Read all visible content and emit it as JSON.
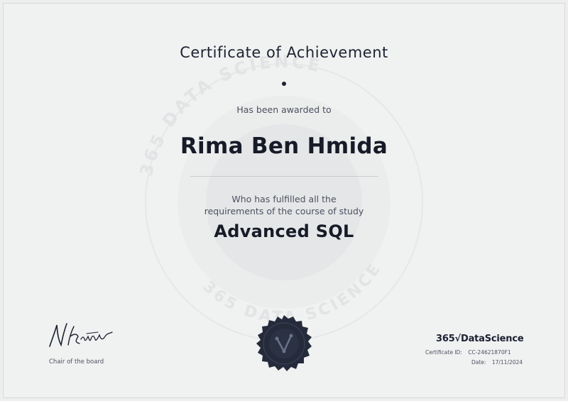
{
  "certificate": {
    "title": "Certificate of Achievement",
    "awarded_text": "Has been awarded to",
    "recipient_name": "Rima Ben Hmida",
    "fulfilled_line1": "Who has fulfilled all the",
    "fulfilled_line2": "requirements of the course of study",
    "course_name": "Advanced SQL"
  },
  "signature": {
    "role": "Chair of the board",
    "signature_text": "N Krastev"
  },
  "brand": {
    "name": "365√DataScience",
    "watermark_text": "365 DATA SCIENCE"
  },
  "meta": {
    "id_label": "Certificate ID:",
    "id_value": "CC-24621870F1",
    "date_label": "Date:",
    "date_value": "17/11/2024"
  },
  "colors": {
    "background": "#f0f1f1",
    "ink": "#1b2030",
    "seal": "#252b3b"
  }
}
